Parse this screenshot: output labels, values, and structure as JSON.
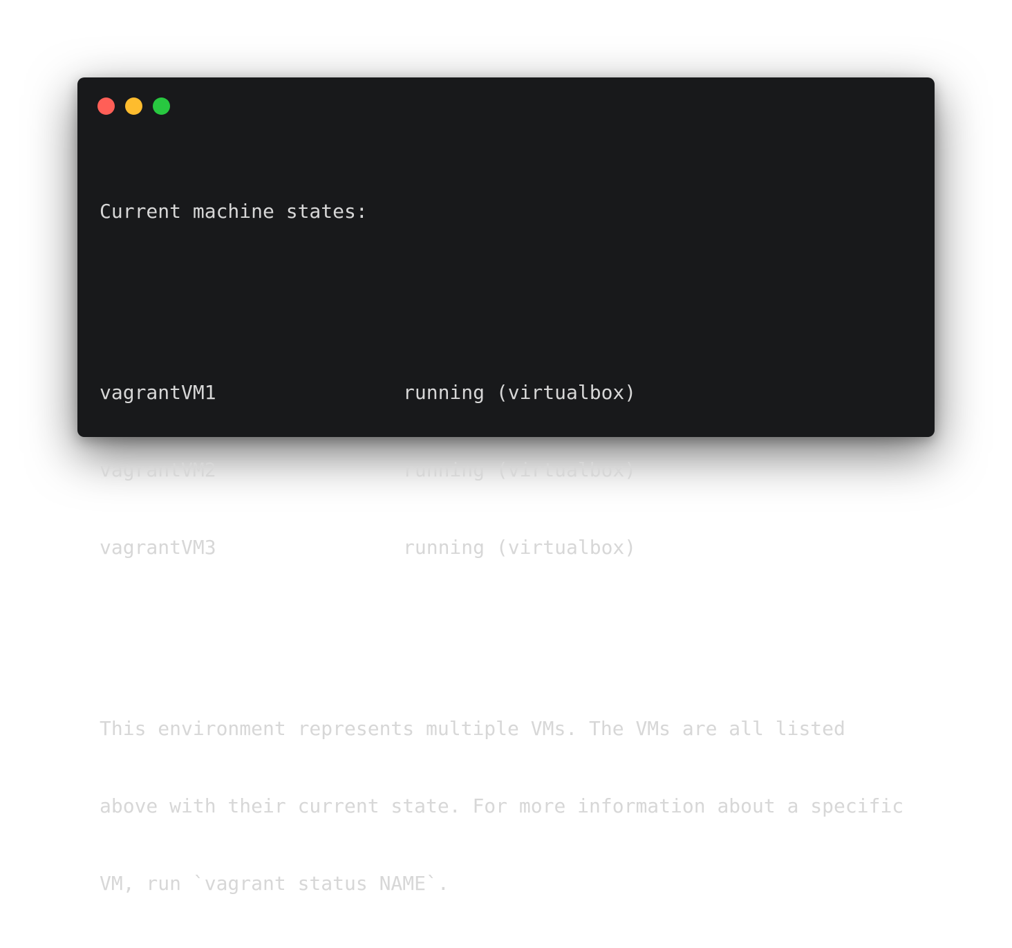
{
  "window": {
    "controls": {
      "close": "close-button",
      "minimize": "minimize-button",
      "zoom": "zoom-button"
    },
    "colors": {
      "background": "#18191b",
      "text": "#d7d7d7",
      "close": "#ff5f57",
      "minimize": "#febc2e",
      "zoom": "#28c840"
    }
  },
  "terminal": {
    "header": "Current machine states:",
    "machines": [
      {
        "name": "vagrantVM1",
        "state": "running (virtualbox)"
      },
      {
        "name": "vagrantVM2",
        "state": "running (virtualbox)"
      },
      {
        "name": "vagrantVM3",
        "state": "running (virtualbox)"
      }
    ],
    "footer": [
      "This environment represents multiple VMs. The VMs are all listed",
      "above with their current state. For more information about a specific",
      "VM, run `vagrant status NAME`."
    ]
  }
}
